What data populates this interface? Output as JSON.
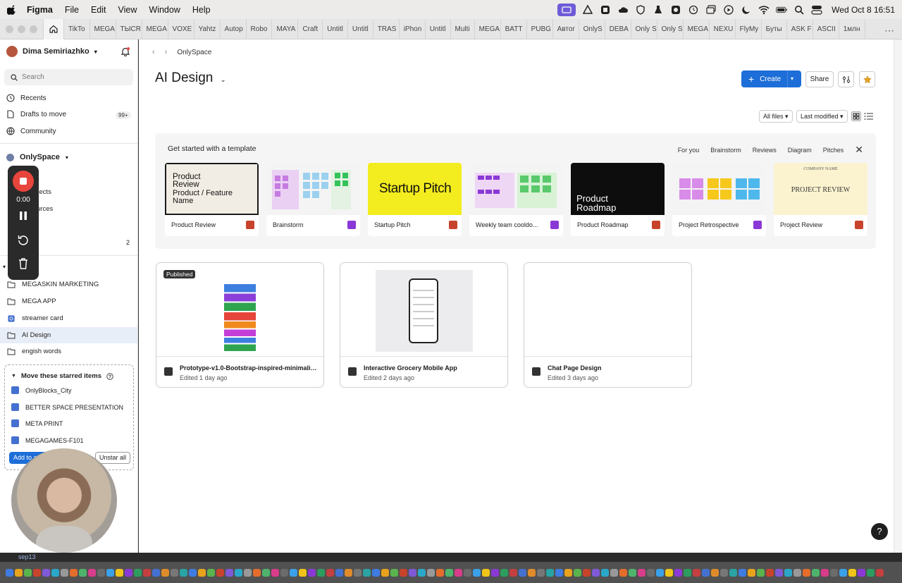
{
  "menubar": {
    "app": "Figma",
    "items": [
      "File",
      "Edit",
      "View",
      "Window",
      "Help"
    ],
    "clock": "Wed Oct 8  16:51"
  },
  "tabs": [
    "TikTo",
    "MEGA",
    "TЫCR",
    "MEGA",
    "VOXE",
    "Yahtz",
    "Autop",
    "Robo",
    "MAYA",
    "Craft",
    "Untitl",
    "Untitl",
    "TRAS",
    "iPhon",
    "Untitl",
    "Multi",
    "MEGA",
    "BATT",
    "PUBG",
    "Автог",
    "OnlyS",
    "DEBA",
    "Only S",
    "Only S",
    "MEGA",
    "NEXU",
    "FlyMy",
    "Буты",
    "ASK F",
    "ASCII",
    "1млн"
  ],
  "sidebar": {
    "user_name": "Dima Semiriazhko",
    "search_placeholder": "Search",
    "nav": [
      {
        "label": "Recents"
      },
      {
        "label": "Drafts to move",
        "badge": "99+"
      },
      {
        "label": "Community"
      }
    ],
    "team_name": "OnlySpace",
    "partial_items": [
      "ojects",
      "urces"
    ],
    "partial_count": "2",
    "folders": [
      "MEGASKIN MARKETING",
      "MEGA APP",
      "streamer card",
      "AI Design",
      "engish words"
    ],
    "active_folder": "AI Design",
    "starred_box": {
      "title": "Move these starred items",
      "items": [
        "OnlyBlocks_City",
        "BETTER SPACE PRESENTATION",
        "META PRINT",
        "MEGAGAMES-F101"
      ],
      "add_button": "Add to a",
      "unstar_button": "Unstar all"
    }
  },
  "recorder": {
    "time": "0:00"
  },
  "taskbar": {
    "label": "sep13"
  },
  "main": {
    "breadcrumb": "OnlySpace",
    "title": "AI Design",
    "create_label": "Create",
    "share_label": "Share",
    "filter_files": "All files",
    "filter_sort": "Last modified",
    "templates": {
      "title": "Get started with a template",
      "tabs": [
        "For you",
        "Brainstorm",
        "Reviews",
        "Diagram",
        "Pitches"
      ],
      "cards": [
        {
          "label": "Product Review",
          "kind": "slides",
          "thumb_text": "Product Review",
          "thumb_sub": "Product / Feature Name"
        },
        {
          "label": "Brainstorm",
          "kind": "jam"
        },
        {
          "label": "Startup Pitch",
          "kind": "slides",
          "thumb_text": "Startup Pitch"
        },
        {
          "label": "Weekly team cooldo...",
          "kind": "jam"
        },
        {
          "label": "Product Roadmap",
          "kind": "slides",
          "thumb_text": "Product Roadmap"
        },
        {
          "label": "Project Retrospective",
          "kind": "jam"
        },
        {
          "label": "Project Review",
          "kind": "slides",
          "thumb_text": "PROJECT REVIEW",
          "thumb_sub": "COMPANY NAME"
        }
      ]
    },
    "files": [
      {
        "title": "Prototype-v1.0-Bootstrap-inspired-minimalisti...",
        "meta": "Edited 1 day ago",
        "badge": "Published"
      },
      {
        "title": "Interactive Grocery Mobile App",
        "meta": "Edited 2 days ago"
      },
      {
        "title": "Chat Page Design",
        "meta": "Edited 3 days ago"
      }
    ],
    "help": "?"
  },
  "colors": {
    "accent": "#1d6ed8",
    "slides": "#c8432b",
    "figjam": "#8b39d6",
    "recorder_stop": "#e8453c"
  }
}
